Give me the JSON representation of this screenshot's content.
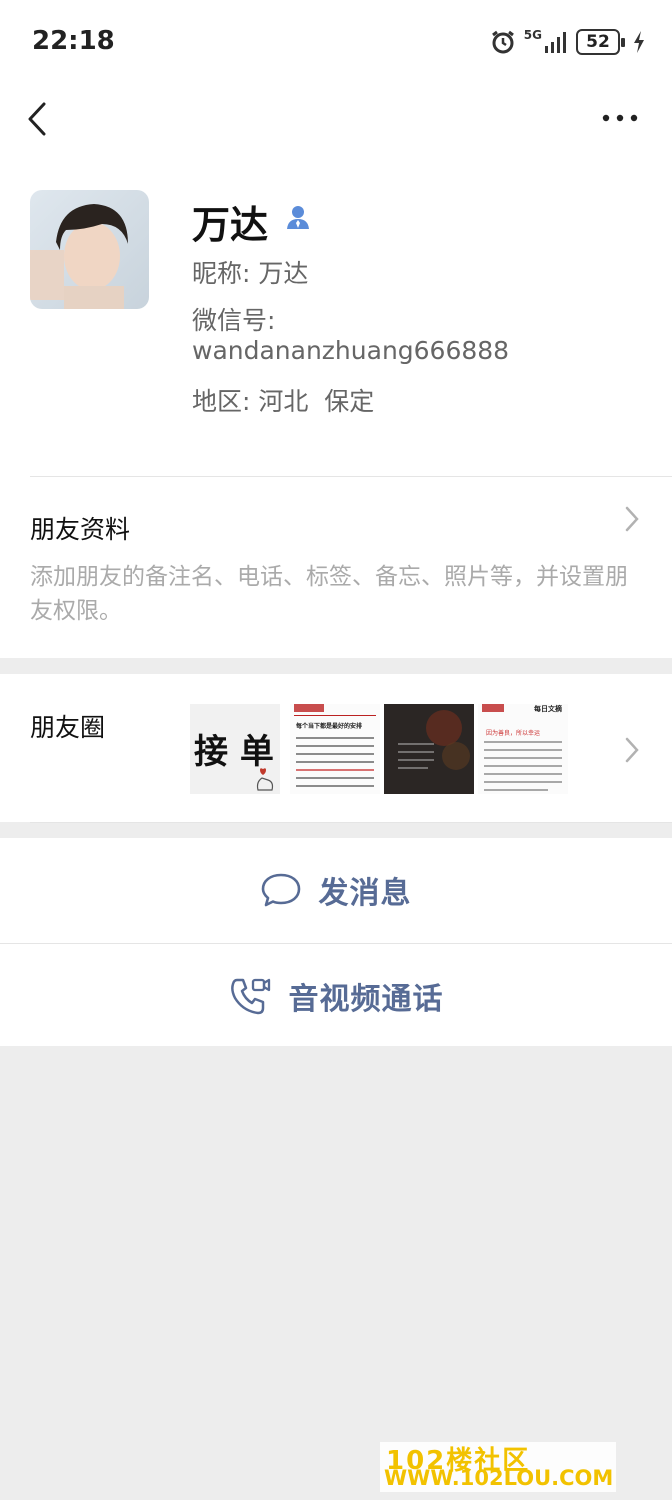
{
  "status_bar": {
    "time": "22:18",
    "network": "5G",
    "battery": "52"
  },
  "profile": {
    "name": "万达",
    "nickname_label": "昵称:",
    "nickname": "万达",
    "wechat_id_label": "微信号:",
    "wechat_id": "wandananzhuang666888",
    "region_label": "地区:",
    "region": "河北  保定"
  },
  "friend_info": {
    "title": "朋友资料",
    "desc": "添加朋友的备注名、电话、标签、备忘、照片等，并设置朋友权限。"
  },
  "moments": {
    "title": "朋友圈",
    "thumb1_text": "接 单",
    "thumb2_header": "每个当下都是最好的安排",
    "thumb4_header": "每日文摘",
    "thumb4_sub": "因为善良，所以幸运"
  },
  "actions": {
    "message": "发消息",
    "call": "音视频通话"
  },
  "watermark": {
    "line1": "102楼社区",
    "line2": "WWW.102LOU.COM"
  },
  "colors": {
    "link": "#576b95",
    "background": "#ededed"
  }
}
